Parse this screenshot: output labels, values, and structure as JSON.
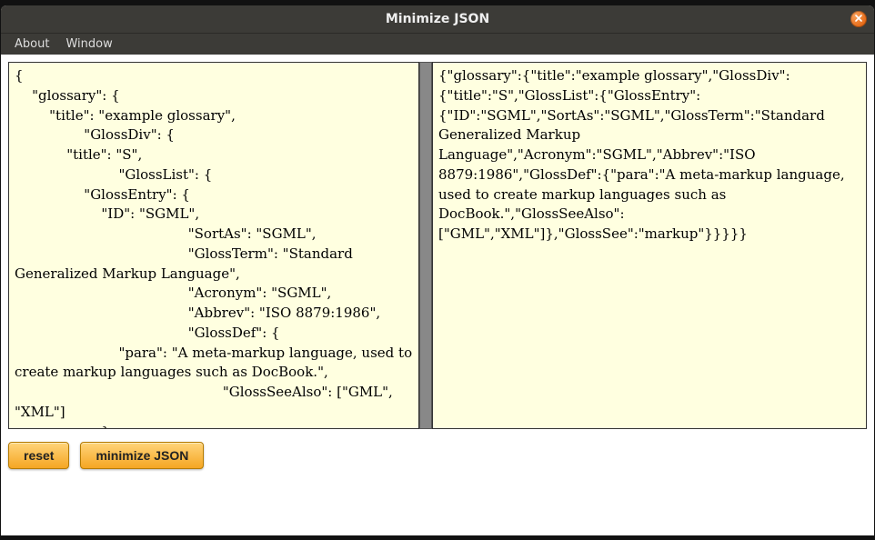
{
  "window": {
    "title": "Minimize JSON"
  },
  "menu": {
    "about": "About",
    "window": "Window"
  },
  "input_json": "{\n    \"glossary\": {\n        \"title\": \"example glossary\",\n\t\t\"GlossDiv\": {\n            \"title\": \"S\",\n\t\t\t\"GlossList\": {\n                \"GlossEntry\": {\n                    \"ID\": \"SGML\",\n\t\t\t\t\t\"SortAs\": \"SGML\",\n\t\t\t\t\t\"GlossTerm\": \"Standard Generalized Markup Language\",\n\t\t\t\t\t\"Acronym\": \"SGML\",\n\t\t\t\t\t\"Abbrev\": \"ISO 8879:1986\",\n\t\t\t\t\t\"GlossDef\": {\n                        \"para\": \"A meta-markup language, used to create markup languages such as DocBook.\",\n\t\t\t\t\t\t\"GlossSeeAlso\": [\"GML\", \"XML\"]\n                    },\n\t\t\t\t\t\"GlossSee\": \"markup\"",
  "output_json": "{\"glossary\":{\"title\":\"example glossary\",\"GlossDiv\":{\"title\":\"S\",\"GlossList\":{\"GlossEntry\":{\"ID\":\"SGML\",\"SortAs\":\"SGML\",\"GlossTerm\":\"Standard Generalized Markup Language\",\"Acronym\":\"SGML\",\"Abbrev\":\"ISO 8879:1986\",\"GlossDef\":{\"para\":\"A meta-markup language, used to create markup languages such as DocBook.\",\"GlossSeeAlso\":[\"GML\",\"XML\"]},\"GlossSee\":\"markup\"}}}}}",
  "buttons": {
    "reset": "reset",
    "minimize": "minimize JSON"
  }
}
